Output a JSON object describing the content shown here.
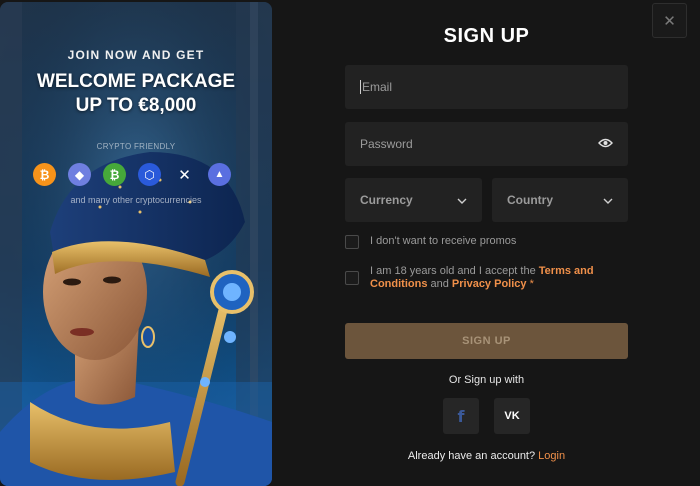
{
  "promo": {
    "eyebrow": "JOIN NOW AND GET",
    "headline_line1": "WELCOME PACKAGE",
    "headline_line2": "UP TO €8,000",
    "crypto_label": "CRYPTO FRIENDLY",
    "coins": [
      {
        "name": "bitcoin",
        "glyph": "₿",
        "color": "#f7931a"
      },
      {
        "name": "ethereum",
        "glyph": "◆",
        "color": "#6f7fe0"
      },
      {
        "name": "bitcoin-cash",
        "glyph": "₿",
        "color": "#46a83a"
      },
      {
        "name": "chainlink",
        "glyph": "⬡",
        "color": "#2a5ada"
      },
      {
        "name": "xrp",
        "glyph": "✕",
        "color": "transparent"
      },
      {
        "name": "cardano",
        "glyph": "▲",
        "color": "#5a6fe0"
      }
    ],
    "other_text": "and many other cryptocurrencies"
  },
  "form": {
    "title": "SIGN UP",
    "email_placeholder": "Email",
    "password_placeholder": "Password",
    "currency_placeholder": "Currency",
    "country_placeholder": "Country",
    "promo_optout": "I don't want to receive promos",
    "terms_prefix": "I am 18 years old and I accept the ",
    "terms_link": "Terms and Conditions",
    "terms_and": " and ",
    "privacy_link": "Privacy Policy",
    "terms_suffix": " *",
    "submit_label": "SIGN UP",
    "or_text": "Or Sign up with",
    "social": [
      {
        "name": "facebook",
        "glyph": "f"
      },
      {
        "name": "vk",
        "glyph": "VK"
      }
    ],
    "have_account": "Already have an account? ",
    "login_link": "Login"
  },
  "colors": {
    "accent": "#f0904a",
    "button": "#6c553c",
    "field_bg": "#222222",
    "background": "#161616"
  }
}
